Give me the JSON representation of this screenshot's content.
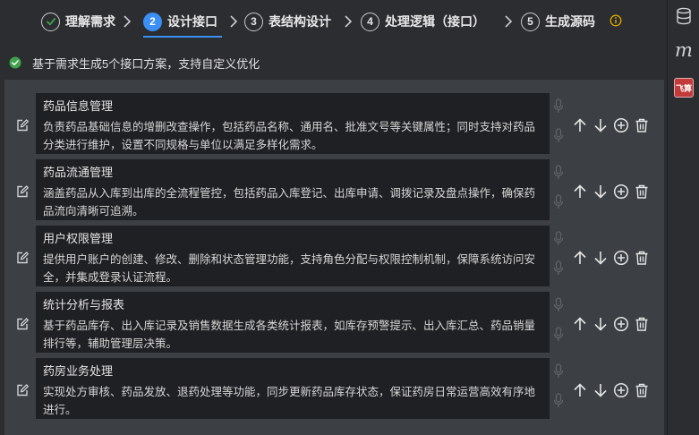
{
  "steps": [
    {
      "num": "✓",
      "label": "理解需求",
      "state": "done"
    },
    {
      "num": "2",
      "label": "设计接口",
      "state": "active"
    },
    {
      "num": "3",
      "label": "表结构设计",
      "state": "pending"
    },
    {
      "num": "4",
      "label": "处理逻辑（接口）",
      "state": "pending"
    },
    {
      "num": "5",
      "label": "生成源码",
      "state": "pending"
    }
  ],
  "notice": "基于需求生成5个接口方案，支持自定义优化",
  "interfaces": [
    {
      "title": "药品信息管理",
      "desc": "负责药品基础信息的增删改查操作，包括药品名称、通用名、批准文号等关键属性；同时支持对药品分类进行维护，设置不同规格与单位以满足多样化需求。"
    },
    {
      "title": "药品流通管理",
      "desc": "涵盖药品从入库到出库的全流程管控，包括药品入库登记、出库申请、调拨记录及盘点操作，确保药品流向清晰可追溯。"
    },
    {
      "title": "用户权限管理",
      "desc": "提供用户账户的创建、修改、删除和状态管理功能，支持角色分配与权限控制机制，保障系统访问安全，并集成登录认证流程。"
    },
    {
      "title": "统计分析与报表",
      "desc": "基于药品库存、出入库记录及销售数据生成各类统计报表，如库存预警提示、出入库汇总、药品销量排行等，辅助管理层决策。"
    },
    {
      "title": "药房业务处理",
      "desc": "实现处方审核、药品发放、退药处理等功能，同步更新药品库存状态，保证药房日常运营高效有序地进行。"
    }
  ],
  "sidebar": {
    "m_label": "m",
    "fs_label": "飞算"
  },
  "colors": {
    "accent": "#3b8ff5",
    "success": "#3fa34d",
    "info": "#e0a800",
    "brand_red": "#c23a3a"
  },
  "icons": [
    "check-icon",
    "chevron-right-icon",
    "info-icon",
    "edit-icon",
    "mic-icon",
    "arrow-up-icon",
    "arrow-down-icon",
    "add-circle-icon",
    "trash-icon",
    "database-icon"
  ]
}
